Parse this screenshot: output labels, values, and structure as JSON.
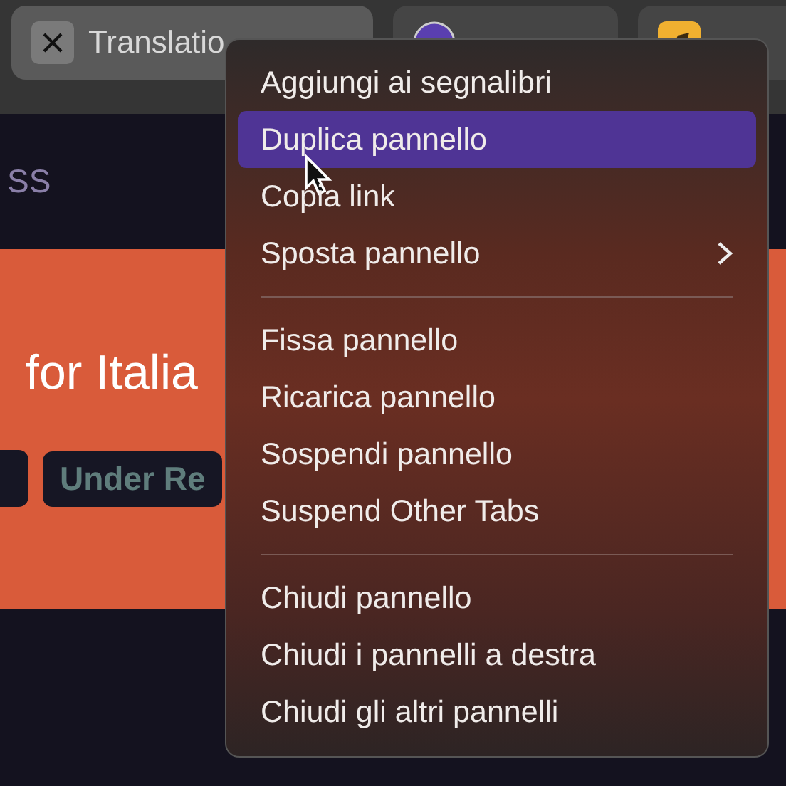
{
  "tabs": [
    {
      "title": "Translatio",
      "selected": true
    },
    {
      "selected": false
    },
    {
      "selected": false
    }
  ],
  "page": {
    "nav_link": "SS",
    "banner_title": "for Italia",
    "badges": [
      {
        "label": "Under Re"
      }
    ]
  },
  "context_menu": {
    "items": [
      {
        "kind": "item",
        "label": "Aggiungi ai segnalibri",
        "selected": false
      },
      {
        "kind": "item",
        "label": "Duplica pannello",
        "selected": true
      },
      {
        "kind": "item",
        "label": "Copia link",
        "selected": false
      },
      {
        "kind": "item",
        "label": "Sposta pannello",
        "selected": false,
        "submenu": true
      },
      {
        "kind": "separator"
      },
      {
        "kind": "item",
        "label": "Fissa pannello",
        "selected": false
      },
      {
        "kind": "item",
        "label": "Ricarica pannello",
        "selected": false
      },
      {
        "kind": "item",
        "label": "Sospendi pannello",
        "selected": false
      },
      {
        "kind": "item",
        "label": "Suspend Other Tabs",
        "selected": false
      },
      {
        "kind": "separator"
      },
      {
        "kind": "item",
        "label": "Chiudi pannello",
        "selected": false
      },
      {
        "kind": "item",
        "label": "Chiudi i pannelli a destra",
        "selected": false
      },
      {
        "kind": "item",
        "label": "Chiudi gli altri pannelli",
        "selected": false
      }
    ]
  }
}
